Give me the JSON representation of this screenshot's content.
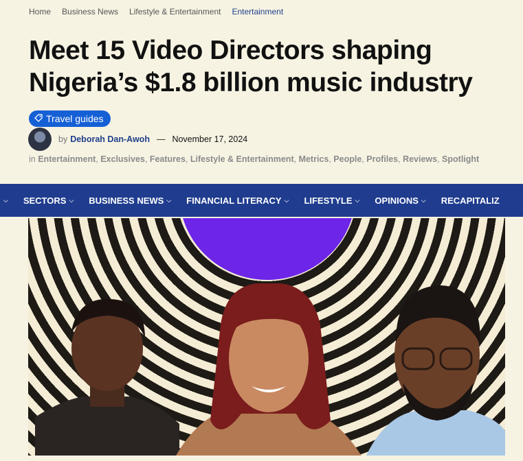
{
  "breadcrumb": {
    "items": [
      "Home",
      "Business News",
      "Lifestyle & Entertainment"
    ],
    "current": "Entertainment"
  },
  "article": {
    "title": "Meet 15 Video Directors shaping Nigeria’s $1.8 billion music industry",
    "tag": "Travel guides",
    "by": "by",
    "author": "Deborah Dan-Awoh",
    "dash": "—",
    "date": "November 17, 2024",
    "in_label": "in",
    "categories": [
      "Entertainment",
      "Exclusives",
      "Features",
      "Lifestyle & Entertainment",
      "Metrics",
      "People",
      "Profiles",
      "Reviews",
      "Spotlight"
    ]
  },
  "nav": {
    "items": [
      "SECTORS",
      "BUSINESS NEWS",
      "FINANCIAL LITERACY",
      "LIFESTYLE",
      "OPINIONS",
      "RECAPITALIZ"
    ]
  },
  "icons": {
    "tag": "tag-icon",
    "chevron": "chevron-down-icon"
  },
  "colors": {
    "background": "#f7f3e3",
    "accent_blue": "#1f3c8e",
    "tag_blue": "#1660d6",
    "hero_purple": "#6d25e8"
  }
}
